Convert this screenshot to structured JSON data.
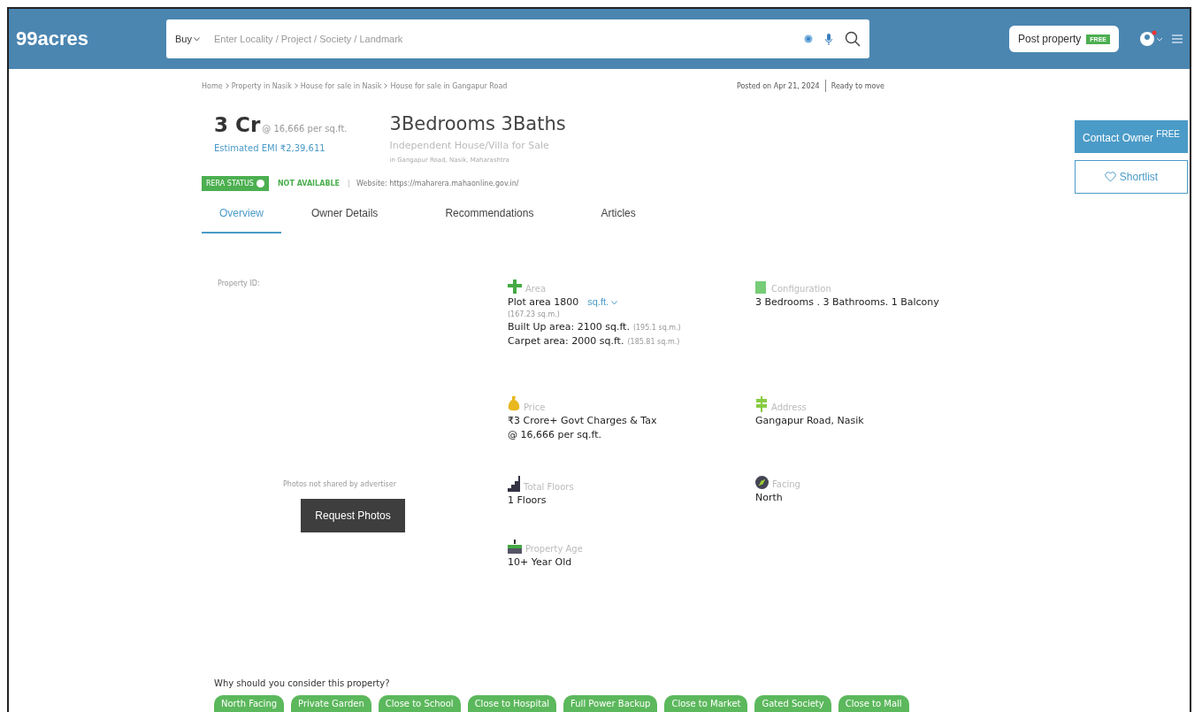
{
  "header": {
    "logo": "99acres",
    "buy": "Buy",
    "search_placeholder": "Enter Locality / Project / Society / Landmark",
    "post_property": "Post property",
    "free_badge": "FREE"
  },
  "breadcrumb": [
    "Home",
    "Property in Nasik",
    "House for sale in Nasik",
    "House for sale in Gangapur Road"
  ],
  "posted": "Posted on Apr 21, 2024",
  "possession": "Ready to move",
  "price": {
    "amount": "3 Cr",
    "rate": "@ 16,666 per sq.ft.",
    "emi": "Estimated EMI ₹2,39,611"
  },
  "title": "3Bedrooms 3Baths",
  "subtitle": "Independent House/Villa for Sale",
  "location": "in Gangapur Road, Nasik, Maharashtra",
  "rera": {
    "label": "RERA STATUS",
    "status": "NOT AVAILABLE",
    "website": "Website: https://maharera.mahaonline.gov.in/"
  },
  "tabs": [
    {
      "label": "Overview",
      "selected": true
    },
    {
      "label": "Owner Details",
      "selected": false
    },
    {
      "label": "Recommendations",
      "selected": false
    },
    {
      "label": "Articles",
      "selected": false
    }
  ],
  "actions": {
    "contact": "Contact Owner",
    "contact_badge": "FREE",
    "shortlist": "Shortlist"
  },
  "photos": {
    "property_id": "Property ID:",
    "note": "Photos not shared by advertiser",
    "button": "Request Photos"
  },
  "details": [
    {
      "label": "Area",
      "lines": [
        {
          "kind": "unit",
          "text": "Plot area 1800",
          "unit": "sq.ft."
        },
        {
          "kind": "note",
          "text": "(167.23 sq.m.)"
        },
        {
          "kind": "value",
          "text": "Built Up area: 2100 sq.ft.",
          "note": "(195.1 sq.m.)"
        },
        {
          "kind": "value",
          "text": "Carpet area: 2000 sq.ft.",
          "note": "(185.81 sq.m.)"
        }
      ]
    },
    {
      "label": "Configuration",
      "lines": [
        {
          "kind": "value",
          "text": "3 Bedrooms . 3 Bathrooms. 1 Balcony"
        }
      ]
    },
    {
      "label": "Price",
      "lines": [
        {
          "kind": "value",
          "text": "₹3 Crore+ Govt Charges & Tax"
        },
        {
          "kind": "value",
          "text": "@ 16,666 per sq.ft."
        }
      ]
    },
    {
      "label": "Address",
      "lines": [
        {
          "kind": "value",
          "text": "Gangapur Road, Nasik"
        }
      ]
    },
    {
      "label": "Total Floors",
      "lines": [
        {
          "kind": "value",
          "text": "1 Floors"
        }
      ]
    },
    {
      "label": "Facing",
      "lines": [
        {
          "kind": "value",
          "text": "North"
        }
      ]
    },
    {
      "label": "Property Age",
      "lines": [
        {
          "kind": "value",
          "text": "10+ Year Old"
        }
      ]
    }
  ],
  "why": {
    "title": "Why should you consider this property?",
    "chips": [
      "North Facing",
      "Private Garden",
      "Close to School",
      "Close to Hospital",
      "Full Power Backup",
      "Close to Market",
      "Gated Society",
      "Close to Mall"
    ]
  }
}
